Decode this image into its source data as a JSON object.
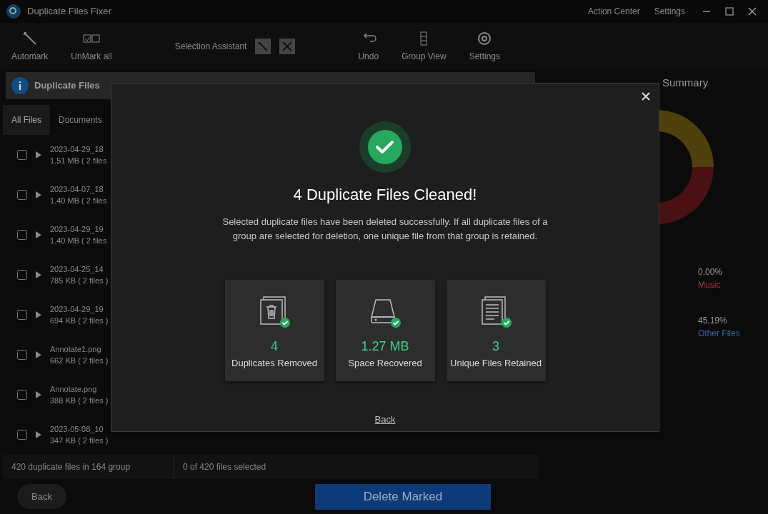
{
  "window": {
    "title": "Duplicate Files Fixer",
    "header_links": [
      "Action Center",
      "Settings"
    ]
  },
  "toolbar": {
    "items": [
      {
        "label": "Automark",
        "kind": "wand"
      },
      {
        "label": "UnMark all",
        "kind": "unmark"
      },
      {
        "label": "Undo",
        "kind": "undo"
      },
      {
        "label": "Group View",
        "kind": "group"
      },
      {
        "label": "Settings",
        "kind": "gear"
      }
    ],
    "selection_assistant": "Selection Assistant"
  },
  "banner": {
    "title": "Duplicate Files"
  },
  "tabs": [
    {
      "label": "All Files",
      "selected": true
    },
    {
      "label": "Documents",
      "selected": false
    }
  ],
  "groups": [
    {
      "name": "2023-04-29_18",
      "size": "1.51 MB ( 2 files",
      "checked": false
    },
    {
      "name": "2023-04-07_18",
      "size": "1.40 MB ( 2 files",
      "checked": false
    },
    {
      "name": "2023-04-29_19",
      "size": "1.40 MB ( 2 files",
      "checked": false
    },
    {
      "name": "2023-04-25_14",
      "size": "785 KB ( 2 files )",
      "checked": false
    },
    {
      "name": "2023-04-29_19",
      "size": "694 KB ( 2 files )",
      "checked": false
    },
    {
      "name": "Annotate1.png",
      "size": "662 KB ( 2 files )",
      "checked": false
    },
    {
      "name": "Annotate.png",
      "size": "388 KB ( 2 files )",
      "checked": false
    },
    {
      "name": "2023-05-08_10",
      "size": "347 KB ( 2 files )",
      "checked": false
    }
  ],
  "status_bar": [
    "420 duplicate files in 164 group",
    "0 of 420 files selected"
  ],
  "footer_buttons": {
    "back": "Back",
    "delete": "Delete Marked"
  },
  "summary": {
    "title": "Summary",
    "stats": [
      {
        "value": "0.00%",
        "label": "Music",
        "color": "#a8343b"
      },
      {
        "value": "45.19%",
        "label": "Other Files",
        "color": "#3a64a0"
      }
    ]
  },
  "dialog": {
    "title": "4 Duplicate Files Cleaned!",
    "message": "Selected duplicate files have been deleted successfully. If all duplicate files of a group are selected for deletion, one unique file from that group is retained.",
    "cards": [
      {
        "kind": "trash",
        "value": "4",
        "label": "Duplicates Removed"
      },
      {
        "kind": "drive",
        "value": "1.27 MB",
        "label": "Space Recovered"
      },
      {
        "kind": "docs",
        "value": "3",
        "label": "Unique Files Retained"
      }
    ],
    "link": "Back"
  }
}
